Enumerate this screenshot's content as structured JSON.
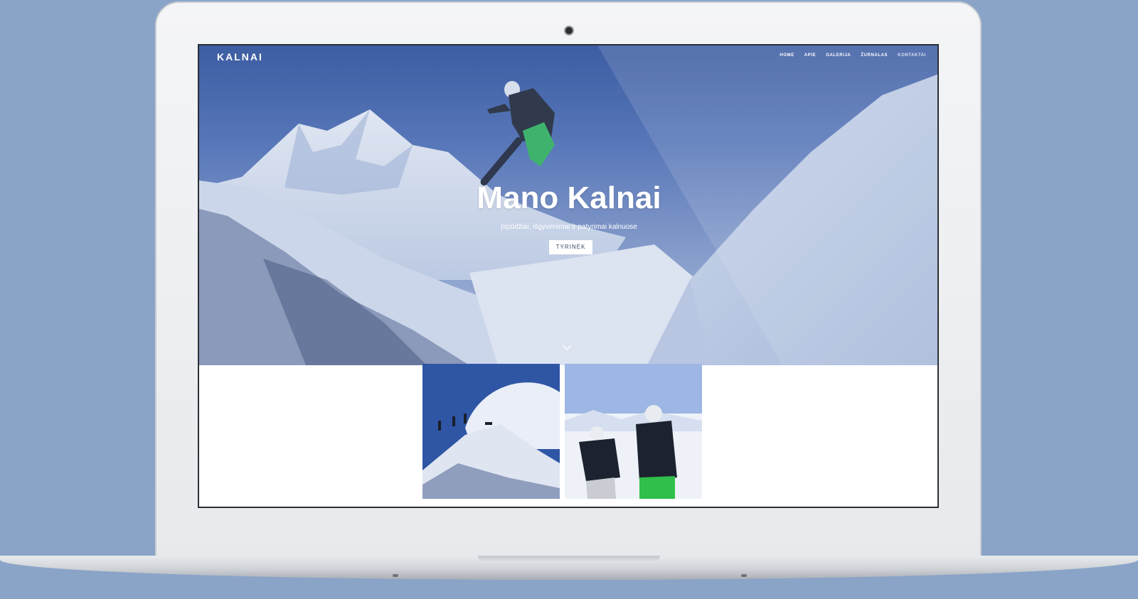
{
  "site": {
    "logo": "KALNAI",
    "nav": [
      "HOME",
      "APIE",
      "GALERIJA",
      "ŽURNALAS",
      "KONTAKTAI"
    ]
  },
  "hero": {
    "title": "Mano Kalnai",
    "subtitle": "Įspūdžiai, išgyvenimai ir patyrimai kalnuose",
    "cta_label": "TYRINĖK"
  },
  "icons": {
    "scroll": "chevron-down-icon",
    "camera": "webcam-icon"
  },
  "colors": {
    "background": "#8aa4c8",
    "hero_sky": "#3a5ca6",
    "cta_text": "#3c4a66"
  }
}
